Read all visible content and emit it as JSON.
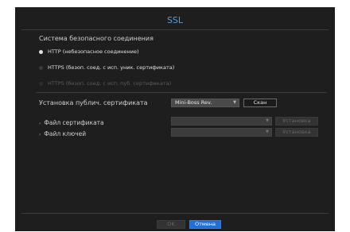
{
  "dialog": {
    "title": "SSL"
  },
  "connection": {
    "section_label": "Система безопасного соединения",
    "options": [
      {
        "label": "HTTP (небезопасное соединение)",
        "selected": true,
        "enabled": true
      },
      {
        "label": "HTTPS (безоп. соед. с исп. уник. сертификата)",
        "selected": false,
        "enabled": true
      },
      {
        "label": "HTTPS (безоп. соед. с исп. пуб. сертификата)",
        "selected": false,
        "enabled": false
      }
    ]
  },
  "public_cert": {
    "label": "Установка публич. сертификата",
    "device_value": "Mini-Boss Rev.",
    "scan_label": "Скан"
  },
  "cert_file": {
    "label": "Файл сертификата",
    "value": "",
    "install_label": "Установка"
  },
  "key_file": {
    "label": "Файл ключей",
    "value": "",
    "install_label": "Установка"
  },
  "footer": {
    "ok_label": "OK",
    "cancel_label": "Отмена"
  },
  "colors": {
    "accent": "#5b9bd5",
    "primary_button": "#1f6fd6",
    "background": "#1e1e1e"
  }
}
